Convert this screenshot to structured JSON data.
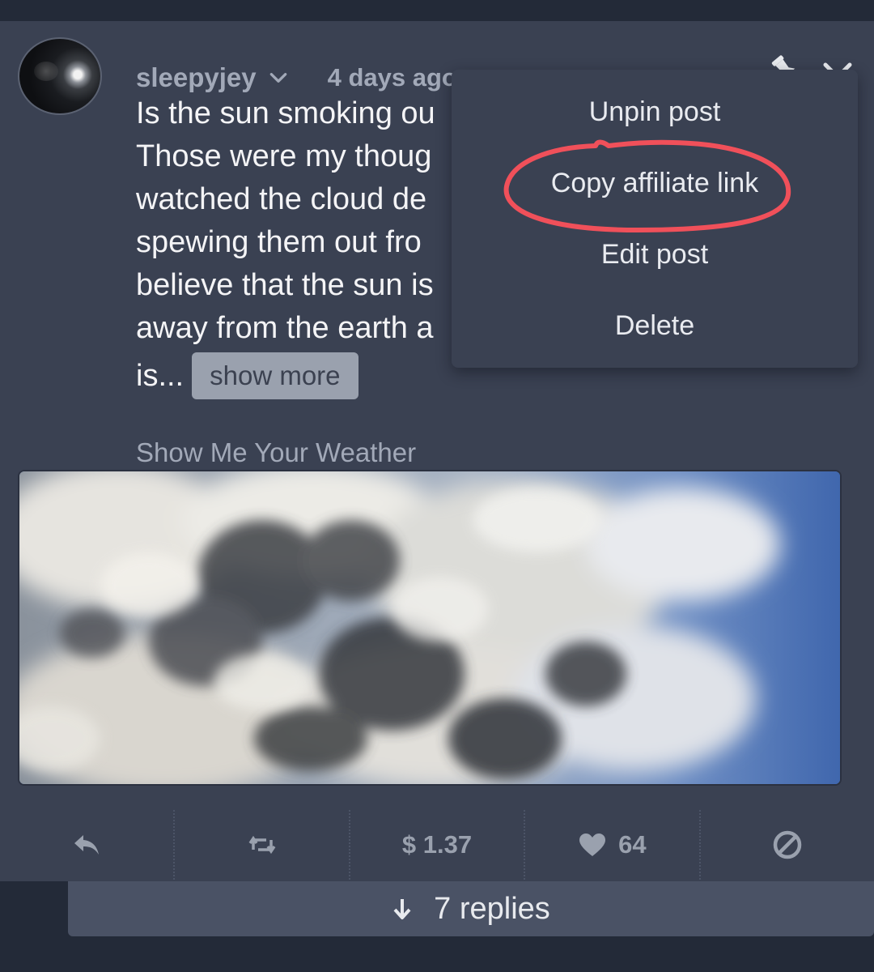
{
  "post": {
    "username": "sleepyjey",
    "timestamp": "4 days ago",
    "text_lines": [
      "Is the sun smoking ou",
      "Those were my thoug",
      "watched the cloud de",
      "spewing them out fro",
      "believe that the sun is",
      "away from the earth a",
      "is..."
    ],
    "show_more_label": "show more",
    "community": "Show Me Your Weather"
  },
  "menu": {
    "items": [
      {
        "label": "Unpin post"
      },
      {
        "label": "Copy affiliate link"
      },
      {
        "label": "Edit post"
      },
      {
        "label": "Delete"
      }
    ],
    "highlighted_item": "Copy affiliate link",
    "highlight_color": "#f0505a"
  },
  "actions": {
    "reply_icon": "reply-icon",
    "resteem_icon": "resteem-icon",
    "payout": "$ 1.37",
    "like_icon": "heart-icon",
    "likes": "64",
    "flag_icon": "ban-icon"
  },
  "replies": {
    "label": "7 replies",
    "icon": "arrow-down-icon"
  },
  "colors": {
    "page_bg": "#232a38",
    "card_bg": "#3a4152",
    "muted_text": "#a2a9b8",
    "primary_text": "#f4f4f6",
    "show_more_bg": "#9aa1ae",
    "replies_bg": "#4a5265"
  }
}
